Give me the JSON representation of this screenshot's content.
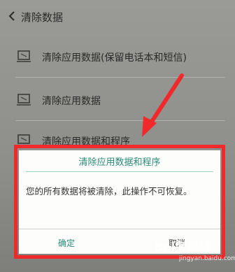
{
  "header": {
    "title": "清除数据"
  },
  "options": [
    {
      "label": "清除应用数据(保留电话本和短信)"
    },
    {
      "label": "清除应用数据"
    },
    {
      "label": "清除应用数据和程序"
    }
  ],
  "dialog": {
    "title": "清除应用数据和程序",
    "message": "您的所有数据将被清除，此操作不可恢复。",
    "confirm_label": "确定",
    "cancel_label": "取消"
  },
  "watermark": {
    "brand": "Bai度经验",
    "url": "jingyan.baidu.com"
  },
  "colors": {
    "annotation_red": "#f02a2a",
    "accent_teal": "#2a8a78"
  }
}
